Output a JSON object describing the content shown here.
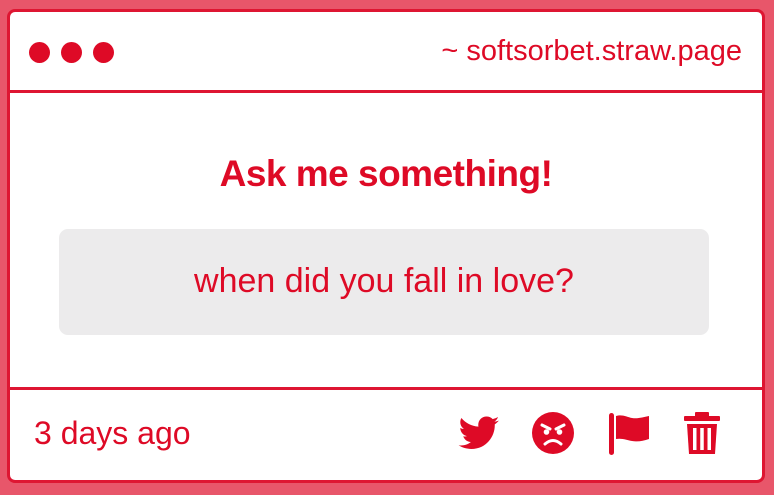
{
  "window": {
    "url": "~ softsorbet.straw.page"
  },
  "main": {
    "heading": "Ask me something!",
    "question": "when did you fall in love?"
  },
  "footer": {
    "timestamp": "3 days ago",
    "actions": [
      "twitter-icon",
      "angry-face-icon",
      "flag-icon",
      "trash-icon"
    ]
  },
  "colors": {
    "accent": "#de0a26",
    "background": "#e8566a",
    "card": "#ffffff",
    "question_box": "#ecebec"
  }
}
